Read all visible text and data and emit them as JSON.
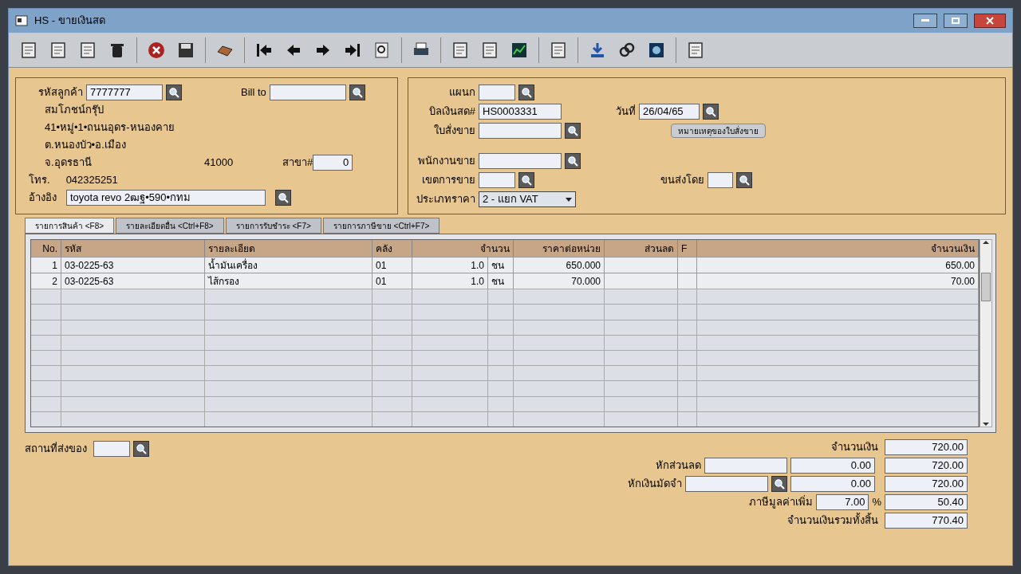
{
  "window": {
    "title": "HS - ขายเงินสด"
  },
  "customer": {
    "code_label": "รหัสลูกค้า",
    "code": "7777777",
    "bill_to_label": "Bill to",
    "name": "สมโภชน์กรุ๊ป",
    "address_1": "41•หมู่•1•ถนนอุดร-หนองคาย",
    "address_2": "ต.หนองบัว•อ.เมือง",
    "province": "จ.อุดรธานี",
    "postcode": "41000",
    "branch_label": "สาขา#",
    "branch": "0",
    "phone_label": "โทร.",
    "phone": "042325251",
    "reference_label": "อ้างอิง",
    "reference": "toyota revo 2ฒฐ•590•กทม"
  },
  "document": {
    "department_label": "แผนก",
    "cash_bill_label": "บิลเงินสด#",
    "cash_bill": "HS0003331",
    "date_label": "วันที่",
    "date": "26/04/65",
    "sales_order_label": "ใบสั่งขาย",
    "note_button": "หมายเหตุของใบสั่งขาย",
    "salesperson_label": "พนักงานขาย",
    "sales_area_label": "เขตการขาย",
    "shipped_by_label": "ขนส่งโดย",
    "price_type_label": "ประเภทราคา",
    "price_type": "2 - แยก VAT"
  },
  "tabs": [
    {
      "label": "รายการสินค้า <F8>",
      "selected": true
    },
    {
      "label": "รายละเอียดอื่น <Ctrl+F8>",
      "selected": false
    },
    {
      "label": "รายการรับชำระ <F7>",
      "selected": false
    },
    {
      "label": "รายการภาษีขาย <Ctrl+F7>",
      "selected": false
    }
  ],
  "table": {
    "columns": [
      "No.",
      "รหัส",
      "รายละเอียด",
      "คลัง",
      "จำนวน",
      "ราคาต่อหน่วย",
      "ส่วนลด",
      "F",
      "จำนวนเงิน"
    ],
    "rows": [
      {
        "no": "1",
        "code": "03-0225-63",
        "description": "น้ำมันเครื่อง",
        "warehouse": "01",
        "quantity": "1.0",
        "unit": "ชน",
        "unit_price": "650.000",
        "amount": "650.00"
      },
      {
        "no": "2",
        "code": "03-0225-63",
        "description": "ไส้กรอง",
        "warehouse": "01",
        "quantity": "1.0",
        "unit": "ชน",
        "unit_price": "70.000",
        "amount": "70.00"
      }
    ]
  },
  "delivery_place_label": "สถานที่ส่งของ",
  "totals": {
    "amount_label": "จำนวนเงิน",
    "amount": "720.00",
    "discount_label": "หักส่วนลด",
    "discount": "0.00",
    "after_discount": "720.00",
    "deposit_label": "หักเงินมัดจำ",
    "deposit": "0.00",
    "after_deposit": "720.00",
    "vat_label": "ภาษีมูลค่าเพิ่ม",
    "vat_rate": "7.00",
    "percent_sign": "%",
    "vat": "50.40",
    "grand_total_label": "จำนวนเงินรวมทั้งสิ้น",
    "grand_total": "770.40"
  }
}
